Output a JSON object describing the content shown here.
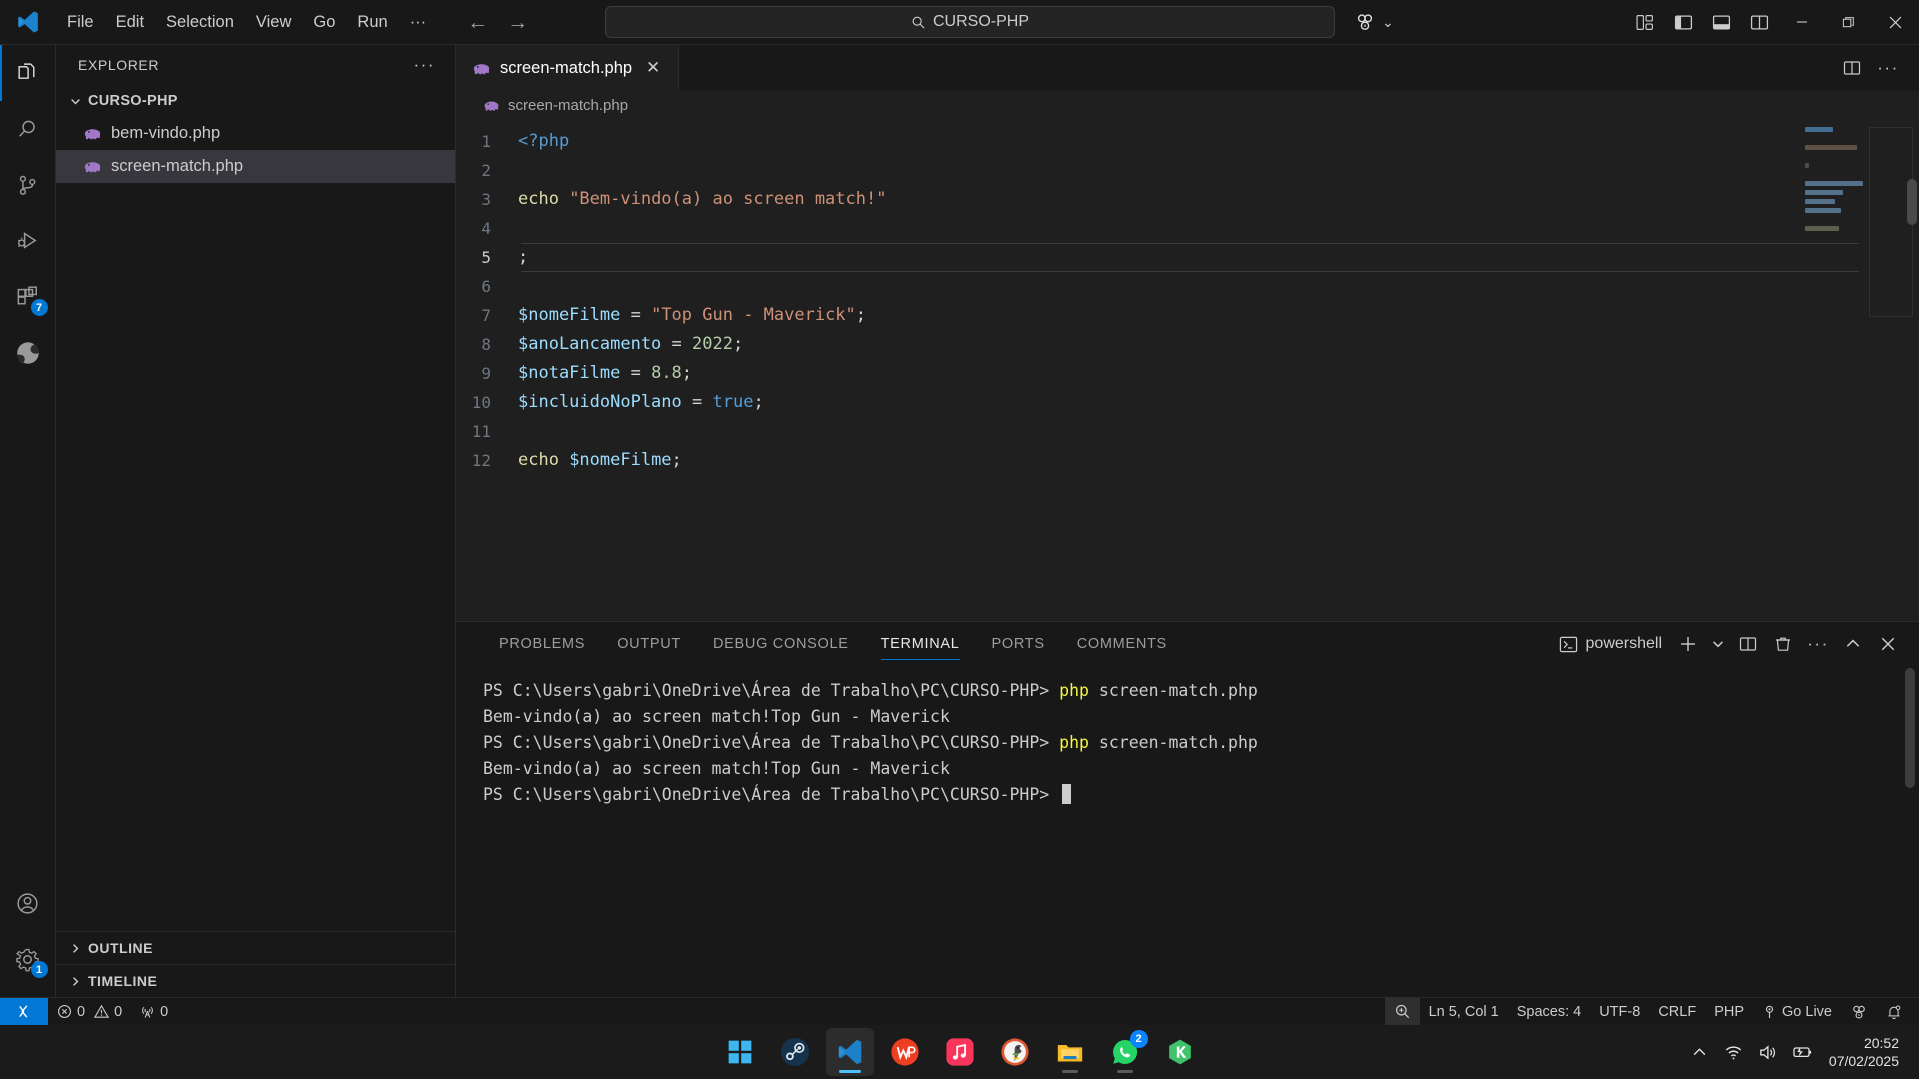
{
  "titlebar": {
    "logo": "vscode-logo",
    "menu": [
      "File",
      "Edit",
      "Selection",
      "View",
      "Go",
      "Run",
      "···"
    ],
    "back_arrow": "←",
    "forward_arrow": "→",
    "quickpick_text": "CURSO-PHP",
    "quickpick_icon": "search-icon",
    "account_icon": "accounts-icon",
    "chevron": "⌄",
    "layout_icons": [
      "customize-layout-icon",
      "toggle-primary-sidebar-icon",
      "toggle-panel-icon",
      "toggle-secondary-sidebar-icon"
    ],
    "window_controls": {
      "minimize": "—",
      "maximize": "❐",
      "close": "✕"
    }
  },
  "activitybar": {
    "items": [
      {
        "name": "explorer",
        "icon": "files-icon",
        "active": true,
        "badge": ""
      },
      {
        "name": "search",
        "icon": "search-icon",
        "active": false,
        "badge": ""
      },
      {
        "name": "source-control",
        "icon": "source-control-icon",
        "active": false,
        "badge": ""
      },
      {
        "name": "run-debug",
        "icon": "run-and-debug-icon",
        "active": false,
        "badge": ""
      },
      {
        "name": "extensions",
        "icon": "extensions-icon",
        "active": false,
        "badge": "7"
      },
      {
        "name": "edge-tools",
        "icon": "edge-browser-icon",
        "active": false,
        "badge": ""
      }
    ],
    "bottom": [
      {
        "name": "accounts",
        "icon": "account-icon",
        "badge": ""
      },
      {
        "name": "settings",
        "icon": "gear-icon",
        "badge": "1"
      }
    ]
  },
  "sidebar": {
    "title": "EXPLORER",
    "more_actions": "···",
    "root_folder": "CURSO-PHP",
    "files": [
      {
        "name": "bem-vindo.php",
        "icon": "php-file-icon",
        "selected": false
      },
      {
        "name": "screen-match.php",
        "icon": "php-file-icon",
        "selected": true
      }
    ],
    "sections": [
      "OUTLINE",
      "TIMELINE"
    ]
  },
  "editor": {
    "tab": {
      "label": "screen-match.php",
      "icon": "php-file-icon",
      "close": "✕"
    },
    "toolbar_icons": [
      "split-editor-icon",
      "more-actions-icon"
    ],
    "breadcrumb": "screen-match.php",
    "breadcrumb_icon": "php-file-icon",
    "current_line": 5,
    "lines": [
      {
        "n": "1",
        "tokens": [
          {
            "t": "<?php",
            "c": "k-tag"
          }
        ]
      },
      {
        "n": "2",
        "tokens": []
      },
      {
        "n": "3",
        "tokens": [
          {
            "t": "echo ",
            "c": "k-echo"
          },
          {
            "t": "\"Bem-vindo(a) ao screen match!\"",
            "c": "k-str"
          }
        ]
      },
      {
        "n": "4",
        "tokens": []
      },
      {
        "n": "5",
        "tokens": [
          {
            "t": ";",
            "c": "k-op"
          }
        ]
      },
      {
        "n": "6",
        "tokens": []
      },
      {
        "n": "7",
        "tokens": [
          {
            "t": "$nomeFilme",
            "c": "k-var"
          },
          {
            "t": " = ",
            "c": "k-op"
          },
          {
            "t": "\"Top Gun - Maverick\"",
            "c": "k-str"
          },
          {
            "t": ";",
            "c": "k-op"
          }
        ]
      },
      {
        "n": "8",
        "tokens": [
          {
            "t": "$anoLancamento",
            "c": "k-var"
          },
          {
            "t": " = ",
            "c": "k-op"
          },
          {
            "t": "2022",
            "c": "k-num"
          },
          {
            "t": ";",
            "c": "k-op"
          }
        ]
      },
      {
        "n": "9",
        "tokens": [
          {
            "t": "$notaFilme",
            "c": "k-var"
          },
          {
            "t": " = ",
            "c": "k-op"
          },
          {
            "t": "8.8",
            "c": "k-num"
          },
          {
            "t": ";",
            "c": "k-op"
          }
        ]
      },
      {
        "n": "10",
        "tokens": [
          {
            "t": "$incluidoNoPlano",
            "c": "k-var"
          },
          {
            "t": " = ",
            "c": "k-op"
          },
          {
            "t": "true",
            "c": "k-kw"
          },
          {
            "t": ";",
            "c": "k-op"
          }
        ]
      },
      {
        "n": "11",
        "tokens": []
      },
      {
        "n": "12",
        "tokens": [
          {
            "t": "echo ",
            "c": "k-echo"
          },
          {
            "t": "$nomeFilme",
            "c": "k-var"
          },
          {
            "t": ";",
            "c": "k-op"
          }
        ]
      }
    ]
  },
  "panel": {
    "tabs": [
      {
        "label": "PROBLEMS",
        "active": false
      },
      {
        "label": "OUTPUT",
        "active": false
      },
      {
        "label": "DEBUG CONSOLE",
        "active": false
      },
      {
        "label": "TERMINAL",
        "active": true
      },
      {
        "label": "PORTS",
        "active": false
      },
      {
        "label": "COMMENTS",
        "active": false
      }
    ],
    "shell_name": "powershell",
    "shell_icon": "terminal-powershell-icon",
    "actions": [
      "new-terminal-icon",
      "terminal-dropdown-icon",
      "split-terminal-icon",
      "kill-terminal-icon",
      "more-actions-icon",
      "maximize-panel-icon",
      "close-panel-icon"
    ],
    "terminal_lines": [
      {
        "prompt": "PS C:\\Users\\gabri\\OneDrive\\Área de Trabalho\\PC\\CURSO-PHP> ",
        "cmd": "php screen-match.php",
        "output": ""
      },
      {
        "prompt": "",
        "cmd": "",
        "output": "Bem-vindo(a) ao screen match!Top Gun - Maverick"
      },
      {
        "prompt": "PS C:\\Users\\gabri\\OneDrive\\Área de Trabalho\\PC\\CURSO-PHP> ",
        "cmd": "php screen-match.php",
        "output": ""
      },
      {
        "prompt": "",
        "cmd": "",
        "output": "Bem-vindo(a) ao screen match!Top Gun - Maverick"
      },
      {
        "prompt": "PS C:\\Users\\gabri\\OneDrive\\Área de Trabalho\\PC\\CURSO-PHP> ",
        "cmd": "",
        "output": ""
      }
    ]
  },
  "statusbar": {
    "remote_icon": "remote-window-icon",
    "errors_icon": "error-icon",
    "errors": "0",
    "warnings_icon": "warning-icon",
    "warnings": "0",
    "ports_icon": "radio-tower-icon",
    "ports": "0",
    "zoom_icon": "screencast-zoom-icon",
    "position": "Ln 5, Col 1",
    "spaces": "Spaces: 4",
    "encoding": "UTF-8",
    "eol": "CRLF",
    "language": "PHP",
    "golive_icon": "broadcast-icon",
    "golive": "Go Live",
    "accounts_icon": "accounts-icon",
    "bell_icon": "bell-dot-icon"
  },
  "taskbar": {
    "apps": [
      {
        "name": "start",
        "label": "Windows Start",
        "running": false,
        "badge": ""
      },
      {
        "name": "steam",
        "label": "Steam",
        "running": false,
        "badge": ""
      },
      {
        "name": "vscode",
        "label": "Visual Studio Code",
        "running": true,
        "badge": ""
      },
      {
        "name": "wps-office",
        "label": "WPS Office",
        "running": false,
        "badge": ""
      },
      {
        "name": "music",
        "label": "Music",
        "running": false,
        "badge": ""
      },
      {
        "name": "duckduckgo",
        "label": "DuckDuckGo",
        "running": false,
        "badge": ""
      },
      {
        "name": "file-explorer",
        "label": "File Explorer",
        "running": false,
        "badge": ""
      },
      {
        "name": "whatsapp",
        "label": "WhatsApp",
        "running": false,
        "badge": "2"
      },
      {
        "name": "kaspersky",
        "label": "Kaspersky",
        "running": false,
        "badge": ""
      }
    ],
    "tray": [
      "chevron-up-icon",
      "wifi-icon",
      "volume-icon",
      "battery-icon"
    ],
    "time": "20:52",
    "date": "07/02/2025"
  }
}
